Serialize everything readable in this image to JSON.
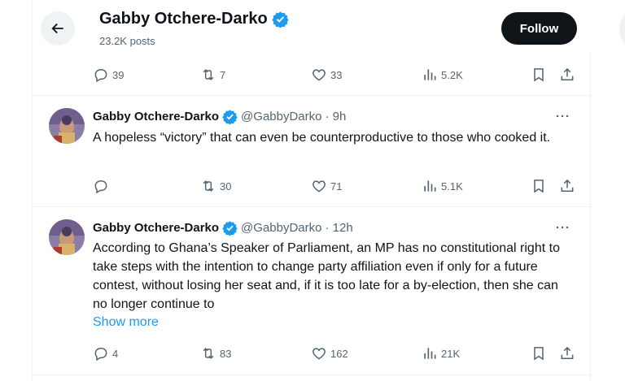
{
  "header": {
    "name": "Gabby Otchere-Darko",
    "posts": "23.2K posts",
    "follow_label": "Follow"
  },
  "colors": {
    "verified": "#1d9bf0",
    "text": "#0f1419",
    "muted": "#536471",
    "link": "#1d9bf0"
  },
  "top_actions": {
    "replies": "39",
    "reposts": "7",
    "likes": "33",
    "views": "5.2K"
  },
  "tweets": [
    {
      "name": "Gabby Otchere-Darko",
      "handle": "@GabbyDarko",
      "time": "· 9h",
      "text": "A hopeless “victory” that can even be counterproductive to those who cooked it.",
      "replies": "",
      "reposts": "30",
      "likes": "71",
      "views": "5.1K"
    },
    {
      "name": "Gabby Otchere-Darko",
      "handle": "@GabbyDarko",
      "time": "· 12h",
      "text": "According to Ghana’s Speaker of Parliament, an MP has no constitutional right to take steps with the intention to change party affiliation even if only for a future contest, without losing her seat and, if it is too late for a by-election, then she can no longer continue to",
      "show_more": "Show more",
      "replies": "4",
      "reposts": "83",
      "likes": "162",
      "views": "21K"
    }
  ],
  "icons": [
    "back-arrow-icon",
    "verified-badge-icon",
    "reply-icon",
    "repost-icon",
    "like-icon",
    "views-icon",
    "bookmark-icon",
    "share-icon",
    "more-icon"
  ]
}
